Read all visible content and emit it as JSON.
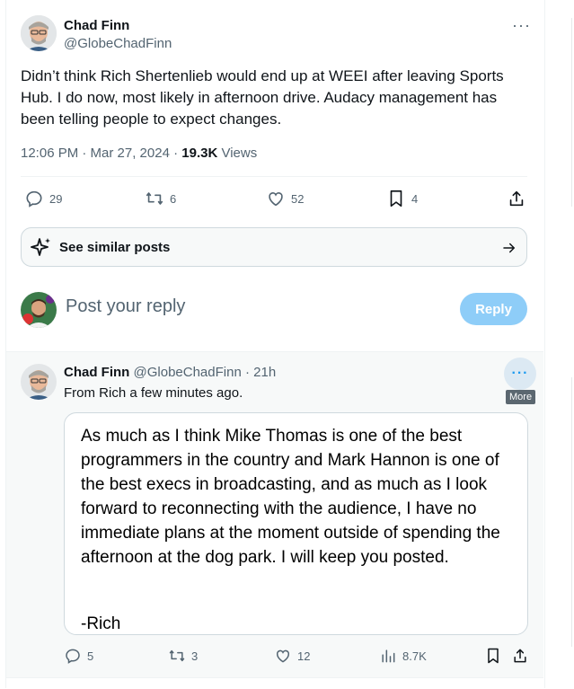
{
  "main_tweet": {
    "author_name": "Chad Finn",
    "author_handle": "@GlobeChadFinn",
    "more_icon": "···",
    "text": "Didn’t think Rich Shertenlieb would end up at WEEI after leaving Sports Hub. I do now, most likely in afternoon drive. Audacy management has been telling people to expect changes.",
    "time": "12:06 PM · Mar 27, 2024 · ",
    "views_count": "19.3K",
    "views_label": " Views",
    "actions": {
      "replies": "29",
      "reposts": "6",
      "likes": "52",
      "bookmarks": "4"
    }
  },
  "similar_posts": {
    "label": "See similar posts"
  },
  "reply_composer": {
    "placeholder": "Post your reply",
    "button": "Reply"
  },
  "reply_tweet": {
    "author_name": "Chad Finn",
    "author_handle": "@GlobeChadFinn",
    "time": "21h",
    "text": "From Rich a few minutes ago.",
    "more_icon": "···",
    "tooltip": "More",
    "image_text": "As much as I think Mike Thomas is one of the best programmers in the country and Mark Hannon is one of the best execs in broadcasting, and as much as I look forward to reconnecting with the audience, I have no immediate plans at the moment outside of spending the afternoon at the dog park. I will keep you posted.",
    "image_signature": "-Rich",
    "actions": {
      "replies": "5",
      "reposts": "3",
      "likes": "12",
      "views": "8.7K"
    }
  },
  "colors": {
    "text": "#0f1419",
    "secondary": "#536471",
    "accent": "#1d9bf0",
    "reply_button_disabled": "#8ecdf8"
  }
}
